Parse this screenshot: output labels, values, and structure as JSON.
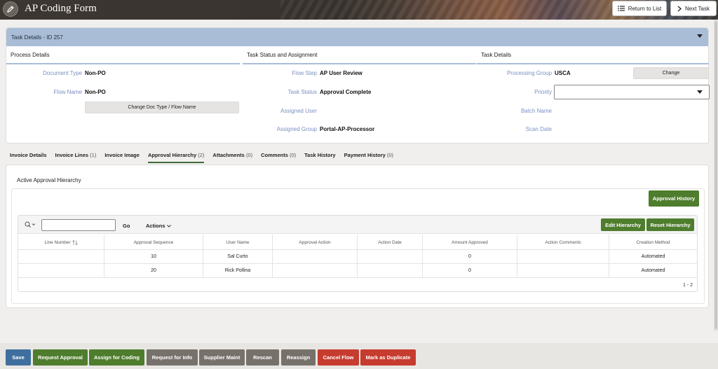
{
  "header": {
    "title": "AP Coding Form",
    "return_label": "Return to List",
    "next_label": "Next Task"
  },
  "task": {
    "bar_title": "Task Details - ID 257",
    "sections": {
      "process": "Process Details",
      "status": "Task Status and Assignment",
      "details": "Task Details"
    },
    "fields": {
      "document_type_label": "Document Type",
      "document_type_value": "Non-PO",
      "flow_name_label": "Flow Name",
      "flow_name_value": "Non-PO",
      "change_doc_btn": "Change Doc Type / Flow Name",
      "flow_step_label": "Flow Step",
      "flow_step_value": "AP User Review",
      "task_status_label": "Task Status",
      "task_status_value": "Approval Complete",
      "assigned_user_label": "Assigned User",
      "assigned_group_label": "Assigned Group",
      "assigned_group_value": "Portal-AP-Processor",
      "processing_group_label": "Processing Group",
      "processing_group_value": "USCA",
      "change_btn": "Change",
      "priority_label": "Priority",
      "priority_value": "",
      "batch_name_label": "Batch Name",
      "scan_date_label": "Scan Date"
    }
  },
  "tabs": [
    {
      "label": "Invoice Details",
      "count": ""
    },
    {
      "label": "Invoice Lines",
      "count": "(1)"
    },
    {
      "label": "Invoice Image",
      "count": ""
    },
    {
      "label": "Approval Hierarchy",
      "count": "(2)"
    },
    {
      "label": "Attachments",
      "count": "(0)"
    },
    {
      "label": "Comments",
      "count": "(0)"
    },
    {
      "label": "Task History",
      "count": ""
    },
    {
      "label": "Payment History",
      "count": "(0)"
    }
  ],
  "hierarchy": {
    "title": "Active Approval Hierarchy",
    "approval_history_btn": "Approval History",
    "search_value": "",
    "go_label": "Go",
    "actions_label": "Actions",
    "edit_btn": "Edit Hierarchy",
    "reset_btn": "Reset Hierarchy",
    "columns": [
      "Line Number",
      "Approval Sequence",
      "User Name",
      "Approval Action",
      "Action Date",
      "Amount Approved",
      "Action Comments",
      "Creation Method"
    ],
    "rows": [
      [
        "",
        "10",
        "Sal Curto",
        "",
        "",
        "0",
        "",
        "Automated"
      ],
      [
        "",
        "20",
        "Rick Pollina",
        "",
        "",
        "0",
        "",
        "Automated"
      ]
    ],
    "pager": "1 - 2"
  },
  "footer": {
    "save": "Save",
    "request_approval": "Request Approval",
    "assign_for_coding": "Assign for Coding",
    "request_for_info": "Request for Info",
    "supplier_maint": "Supplier Maint",
    "rescan": "Rescan",
    "reassign": "Reassign",
    "cancel_flow": "Cancel Flow",
    "mark_duplicate": "Mark as Duplicate"
  }
}
